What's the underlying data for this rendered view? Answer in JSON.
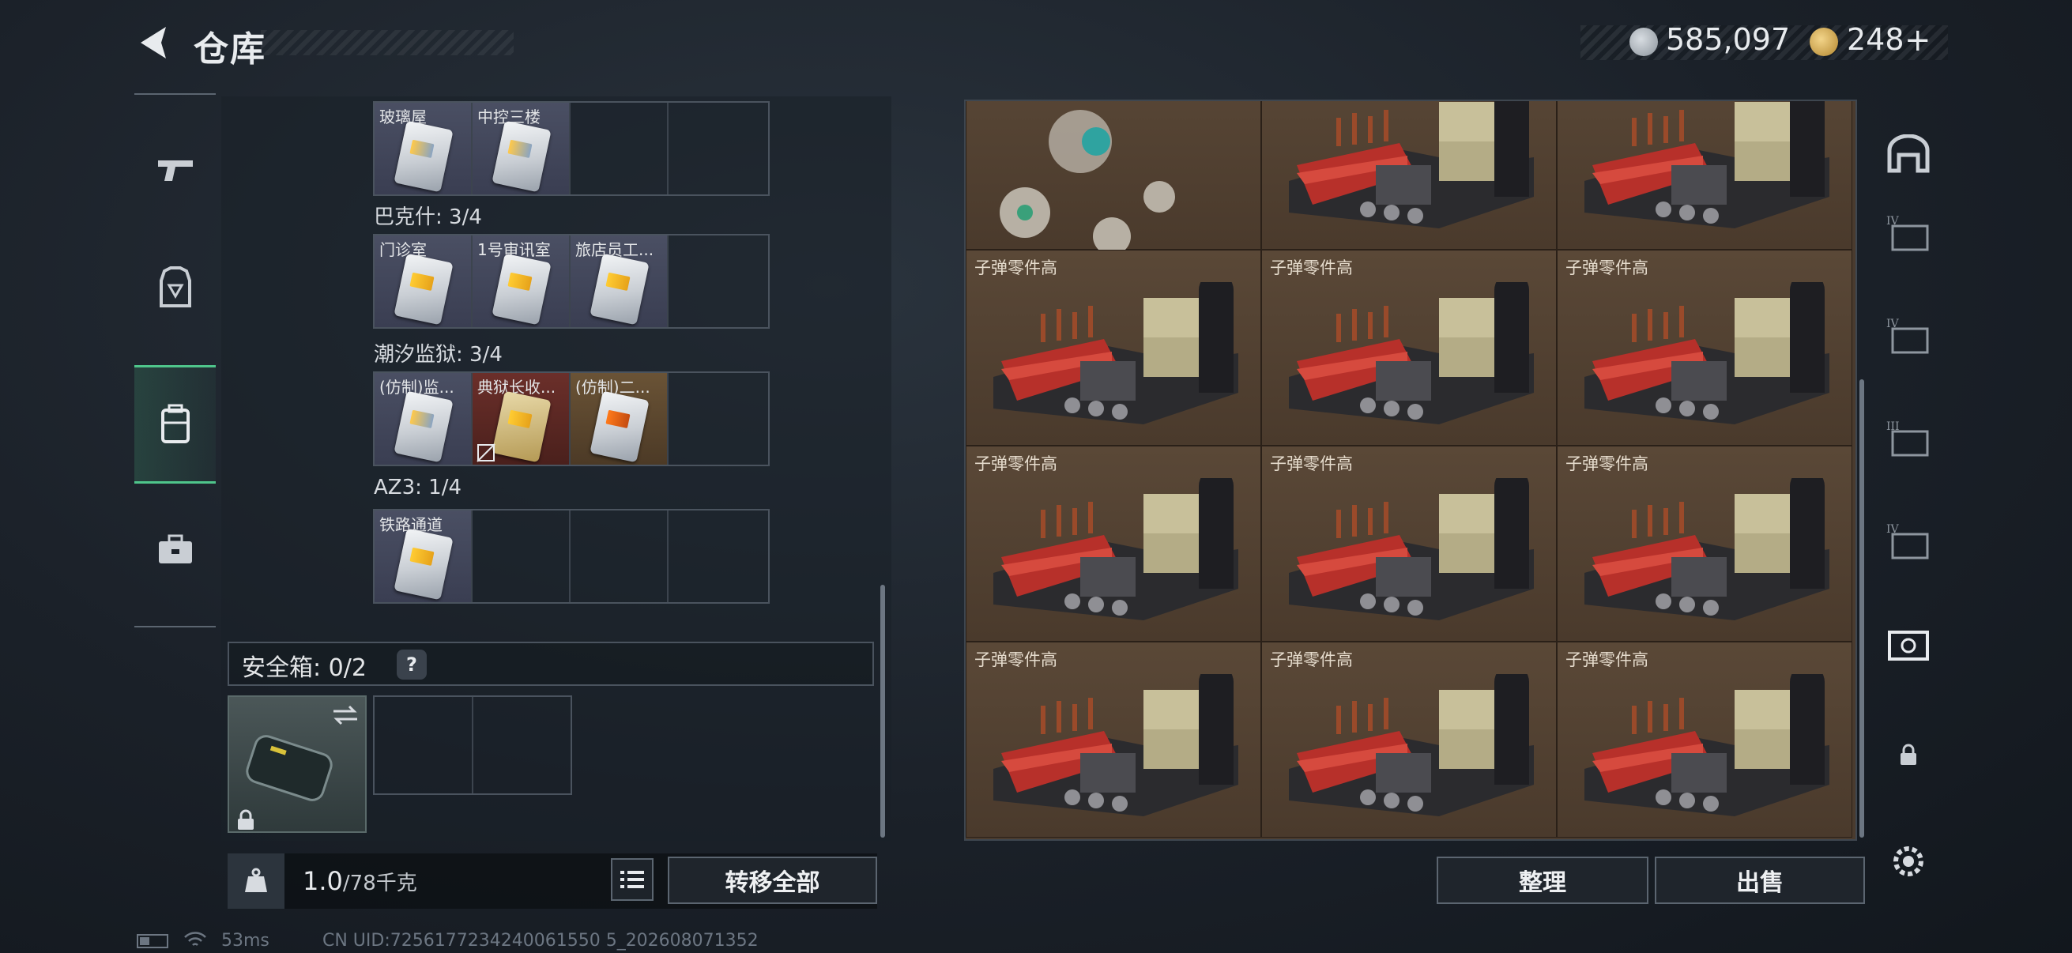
{
  "header": {
    "title": "仓库",
    "currency_silver": "585,097",
    "currency_gold": "248",
    "add_label": "+"
  },
  "categories": [
    "weapon",
    "armor",
    "backpack",
    "toolbox"
  ],
  "keys_section": {
    "top_row": [
      {
        "label": "玻璃屋",
        "tone": "grey"
      },
      {
        "label": "中控三楼",
        "tone": "grey"
      }
    ],
    "groups": [
      {
        "name": "巴克什: 3/4",
        "items": [
          {
            "label": "门诊室",
            "tone": "grey",
            "card": "gold"
          },
          {
            "label": "1号审讯室",
            "tone": "grey",
            "card": "gold"
          },
          {
            "label": "旅店员工...",
            "tone": "grey",
            "card": "gold"
          }
        ]
      },
      {
        "name": "潮汐监狱: 3/4",
        "items": [
          {
            "label": "(仿制)监...",
            "tone": "grey",
            "card": "blue"
          },
          {
            "label": "典狱长收...",
            "tone": "gold",
            "card": "gold"
          },
          {
            "label": "(仿制)二...",
            "tone": "gold",
            "card": "orange"
          }
        ]
      },
      {
        "name": "AZ3: 1/4",
        "items": [
          {
            "label": "铁路通道",
            "tone": "grey",
            "card": "gold"
          }
        ]
      }
    ]
  },
  "safe_box": {
    "label": "安全箱:",
    "count": "0/2",
    "help": "?"
  },
  "weight": {
    "current": "1.0",
    "capacity": "/78千克"
  },
  "buttons": {
    "transfer_all": "转移全部",
    "sort": "整理",
    "sell": "出售"
  },
  "grid_items": [
    {
      "label": ""
    },
    {
      "label": ""
    },
    {
      "label": ""
    },
    {
      "label": "子弹零件高"
    },
    {
      "label": "子弹零件高"
    },
    {
      "label": "子弹零件高"
    },
    {
      "label": "子弹零件高"
    },
    {
      "label": "子弹零件高"
    },
    {
      "label": "子弹零件高"
    },
    {
      "label": "子弹零件高"
    },
    {
      "label": "子弹零件高"
    },
    {
      "label": "子弹零件高"
    }
  ],
  "status": {
    "ping": "53ms",
    "uid": "CN UID:7256177234240061550 5_202608071352"
  },
  "colors": {
    "accent_green": "#4fc58b",
    "bg": "#1b2129"
  }
}
